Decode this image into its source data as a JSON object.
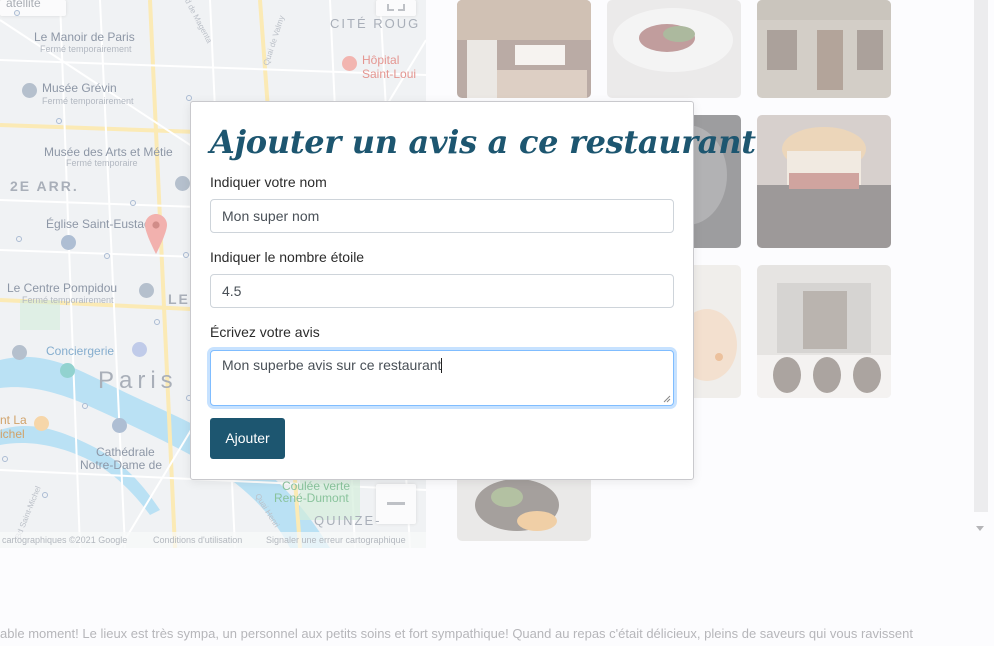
{
  "map": {
    "places": {
      "manoir": {
        "name": "Le Manoir de Paris",
        "status": "Fermé temporairement"
      },
      "grevin": {
        "name": "Musée Grévin",
        "status": "Fermé temporairement"
      },
      "arts": {
        "name": "Musée des Arts et Métie",
        "status": "Fermé temporaire"
      },
      "eglise": {
        "name": "Église Saint-Eustache"
      },
      "pompidou": {
        "name": "Le Centre Pompidou",
        "status": "Fermé temporairement"
      },
      "conciergerie": {
        "name": "Conciergerie"
      },
      "tourla": {
        "name": "nt La",
        "name2": "ichel"
      },
      "cathedrale": {
        "name": "Cathédrale",
        "name2": "Notre-Dame de"
      },
      "coulee": {
        "name": "Coulée verte",
        "name2": "René-Dumont"
      },
      "hopital": {
        "name": "Hôpital",
        "name2": "Saint-Loui"
      }
    },
    "areas": {
      "cite": "CITÉ ROUG",
      "arr2": "2E ARR.",
      "paris": "Paris",
      "quinze": "QUINZE-",
      "le": "LE"
    },
    "streets": {
      "magenta": "Bd de Magenta",
      "valmy": "Quai de Valmy",
      "michel": "Bd Saint-Michel",
      "henri": "Quai Henri"
    },
    "footer": {
      "data": "cartographiques ©2021 Google",
      "terms": "Conditions d'utilisation",
      "report": "Signaler une erreur cartographique"
    },
    "top_left_label": "atellite"
  },
  "modal": {
    "title": "Ajouter un avis a ce restaurant",
    "name_label": "Indiquer votre nom",
    "name_value": "Mon super nom",
    "stars_label": "Indiquer le nombre étoile",
    "stars_value": "4.5",
    "review_label": "Écrivez votre avis",
    "review_value": "Mon superbe avis sur ce restaurant",
    "submit_label": "Ajouter"
  },
  "review_snippet": "able moment! Le lieux est très sympa, un personnel aux petits soins et fort sympathique! Quand au repas c'était délicieux, pleins de saveurs qui vous ravissent",
  "icons": [
    "map-pin-icon",
    "fullscreen-icon",
    "zoom-out-icon",
    "resize-grip-icon",
    "scroll-down-arrow-icon"
  ],
  "colors": {
    "accent": "#1d5670",
    "focus_border": "#80bdff",
    "map_pin": "#e8605a"
  }
}
